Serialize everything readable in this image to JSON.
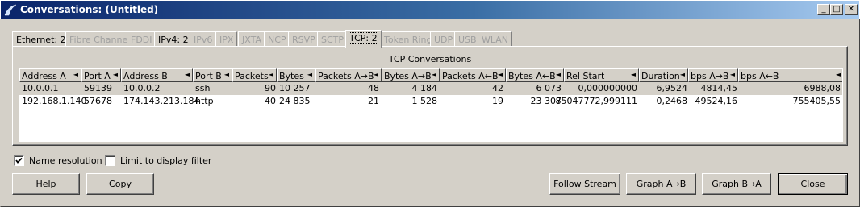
{
  "window": {
    "title": "Conversations: (Untitled)",
    "minimize": "_",
    "maximize": "□",
    "close": "✕"
  },
  "tabs": [
    {
      "label": "Ethernet: 2",
      "enabled": true
    },
    {
      "label": "Fibre Channel",
      "enabled": false
    },
    {
      "label": "FDDI",
      "enabled": false
    },
    {
      "label": "IPv4: 2",
      "enabled": true
    },
    {
      "label": "IPv6",
      "enabled": false
    },
    {
      "label": "IPX",
      "enabled": false
    },
    {
      "label": "JXTA",
      "enabled": false
    },
    {
      "label": "NCP",
      "enabled": false
    },
    {
      "label": "RSVP",
      "enabled": false
    },
    {
      "label": "SCTP",
      "enabled": false
    },
    {
      "label": "TCP: 2",
      "enabled": true,
      "active": true
    },
    {
      "label": "Token Ring",
      "enabled": false
    },
    {
      "label": "UDP",
      "enabled": false
    },
    {
      "label": "USB",
      "enabled": false
    },
    {
      "label": "WLAN",
      "enabled": false
    }
  ],
  "table": {
    "title": "TCP Conversations",
    "columns": [
      "Address A",
      "Port A",
      "Address B",
      "Port B",
      "Packets",
      "Bytes",
      "Packets A→B",
      "Bytes A→B",
      "Packets A←B",
      "Bytes A←B",
      "Rel Start",
      "Duration",
      "bps A→B",
      "bps A←B"
    ],
    "rows": [
      [
        "10.0.0.1",
        "59139",
        "10.0.0.2",
        "ssh",
        "90",
        "10 257",
        "48",
        "4 184",
        "42",
        "6 073",
        "0,000000000",
        "6,9524",
        "4814,45",
        "6988,08"
      ],
      [
        "192.168.1.140",
        "57678",
        "174.143.213.184",
        "http",
        "40",
        "24 835",
        "21",
        "1 528",
        "19",
        "23 307",
        "85047772,999111",
        "0,2468",
        "49524,16",
        "755405,55"
      ]
    ],
    "sort_arrow": "◄"
  },
  "options": {
    "name_resolution": {
      "label": "Name resolution",
      "checked": true
    },
    "limit_filter": {
      "label": "Limit to display filter",
      "checked": false
    }
  },
  "buttons": {
    "help": "Help",
    "copy": "Copy",
    "follow_stream": "Follow Stream",
    "graph_ab": "Graph A→B",
    "graph_ba": "Graph B→A",
    "close": "Close"
  },
  "colors": {
    "titlebar_start": "#0a246a",
    "titlebar_end": "#a6caf0",
    "face": "#d4d0c8",
    "disabled_text": "#a0a0a0"
  }
}
